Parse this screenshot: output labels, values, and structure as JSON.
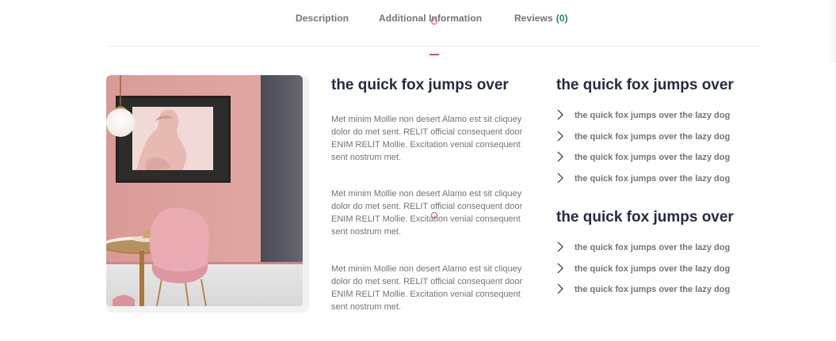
{
  "tabs": {
    "description": "Description",
    "additional_information": "Additional Information",
    "reviews": "Reviews",
    "reviews_count": "(0)",
    "active": "additional_information"
  },
  "accent_color": "#e03d8f",
  "count_color": "#23856d",
  "image": {
    "alt": "Pink dining room with chair, table, pendant lamp and framed classical artwork"
  },
  "middle": {
    "title": "the quick fox jumps over",
    "paragraphs": [
      "Met minim Mollie non desert Alamo est sit cliquey dolor do met sent. RELIT official consequent door ENIM RELIT Mollie. Excitation venial consequent sent nostrum met.",
      "Met minim Mollie non desert Alamo est sit cliquey dolor do met sent. RELIT official consequent door ENIM RELIT Mollie. Excitation venial consequent sent nostrum met.",
      "Met minim Mollie non desert Alamo est sit cliquey dolor do met sent. RELIT official consequent door ENIM RELIT Mollie. Excitation venial consequent sent nostrum met."
    ]
  },
  "right": {
    "title_a": "the quick fox jumps over",
    "list_a": [
      "the quick fox jumps over the lazy dog",
      "the quick fox jumps over the lazy dog",
      "the quick fox jumps over the lazy dog",
      "the quick fox jumps over the lazy dog"
    ],
    "title_b": "the quick fox jumps over",
    "list_b": [
      "the quick fox jumps over the lazy dog",
      "the quick fox jumps over the lazy dog",
      "the quick fox jumps over the lazy dog"
    ],
    "list_icon": "chevron-right-icon"
  }
}
